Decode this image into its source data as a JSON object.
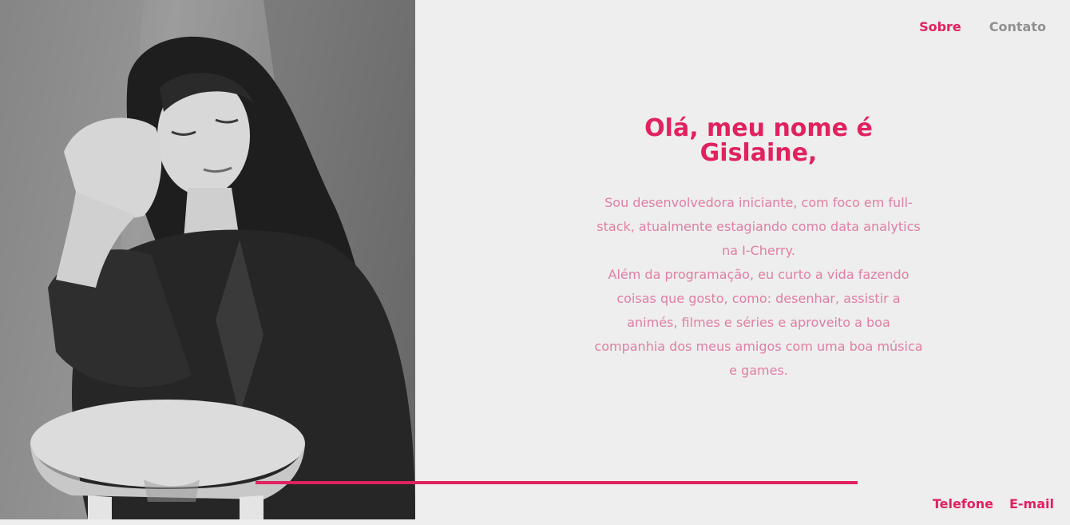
{
  "colors": {
    "accent": "#e2215f",
    "text_soft": "#e07ea3",
    "nav_inactive": "#909090",
    "background": "#eeeeee"
  },
  "nav": {
    "items": [
      {
        "label": "Sobre",
        "active": true
      },
      {
        "label": "Contato",
        "active": false
      }
    ]
  },
  "hero": {
    "title_line1": "Olá, meu nome é",
    "title_line2": "Gislaine,",
    "bio_paragraph1": "Sou desenvolvedora iniciante, com foco em full-stack, atualmente estagiando como data analytics na I-Cherry.",
    "bio_paragraph2": "Além da programação, eu curto a vida fazendo coisas que gosto, como: desenhar, assistir a animés, filmes e séries e aproveito a boa companhia dos meus amigos com uma boa música e games."
  },
  "footer": {
    "links": [
      {
        "label": "Telefone"
      },
      {
        "label": "E-mail"
      }
    ]
  }
}
